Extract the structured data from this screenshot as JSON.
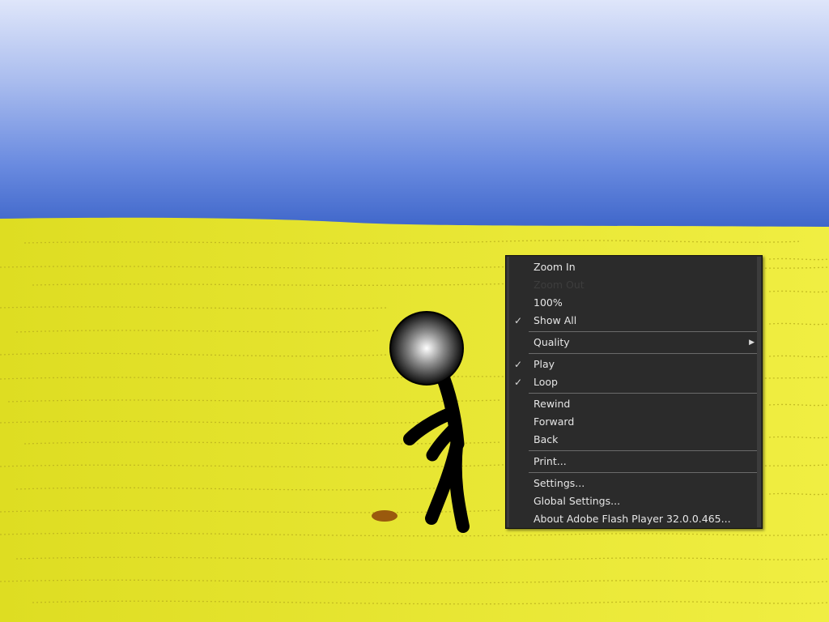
{
  "colors": {
    "sky_top": "#d9e1f7",
    "sky_bottom": "#3a62c7",
    "ground": "#e4e32a",
    "ground_stroke": "#b7ae1c",
    "stick": "#000000",
    "stone": "#9a5a0e",
    "menu_bg": "#2b2b2b",
    "menu_text": "#e6e6e6",
    "menu_disabled": "#3d3d3d"
  },
  "scene": {
    "character": "stickman-figure",
    "object": "brown-stone"
  },
  "context_menu": {
    "zoom_in": "Zoom In",
    "zoom_out": "Zoom Out",
    "zoom_100": "100%",
    "show_all": "Show All",
    "show_all_checked": true,
    "quality": "Quality",
    "play": "Play",
    "play_checked": true,
    "loop": "Loop",
    "loop_checked": true,
    "rewind": "Rewind",
    "forward": "Forward",
    "back": "Back",
    "print": "Print...",
    "settings": "Settings...",
    "global_settings": "Global Settings...",
    "about": "About Adobe Flash Player 32.0.0.465...",
    "check_glyph": "✓",
    "submenu_arrow_icon": "▶"
  }
}
